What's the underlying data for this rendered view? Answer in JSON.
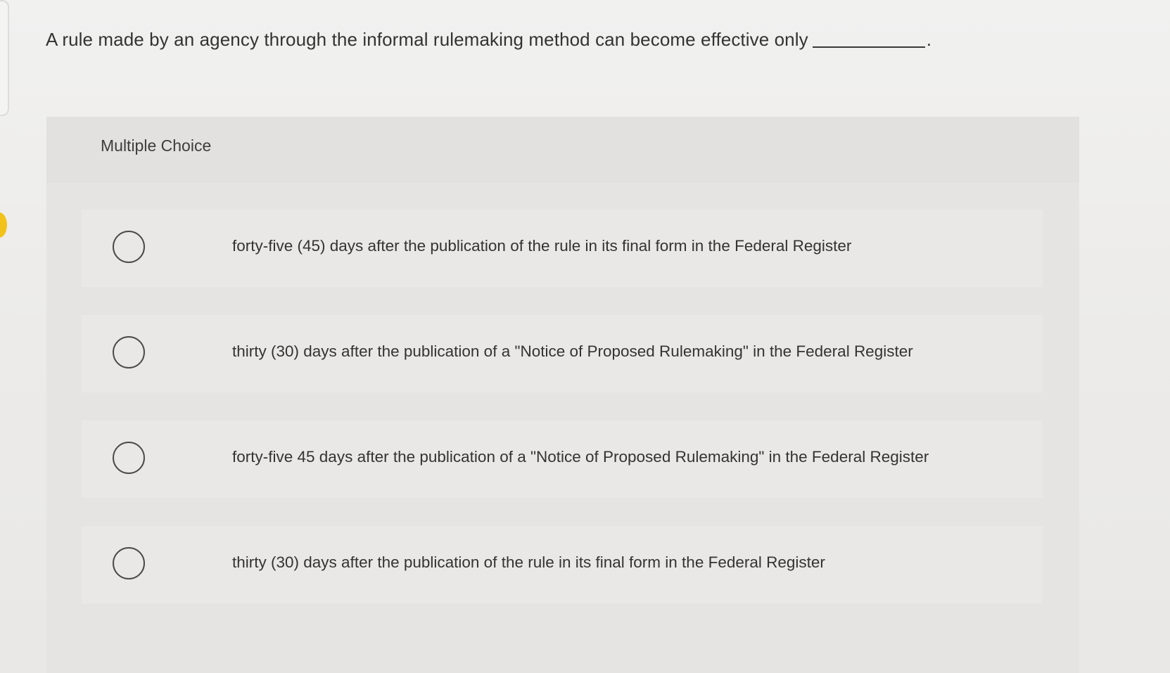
{
  "question": {
    "text": "A rule made by an agency through the informal rulemaking method can become effective only",
    "end_punct": "."
  },
  "panel": {
    "title": "Multiple Choice"
  },
  "options": [
    {
      "label": "forty-five (45) days after the publication of the rule in its final form in the Federal Register"
    },
    {
      "label": "thirty (30) days after the publication of a \"Notice of Proposed Rulemaking\" in the Federal Register"
    },
    {
      "label": "forty-five 45 days after the publication of a \"Notice of Proposed Rulemaking\" in the Federal Register"
    },
    {
      "label": "thirty (30) days after the publication of the rule in its final form in the Federal Register"
    }
  ],
  "icons": {
    "radio": "radio-unselected-icon"
  },
  "colors": {
    "marker": "#f2c21a"
  }
}
